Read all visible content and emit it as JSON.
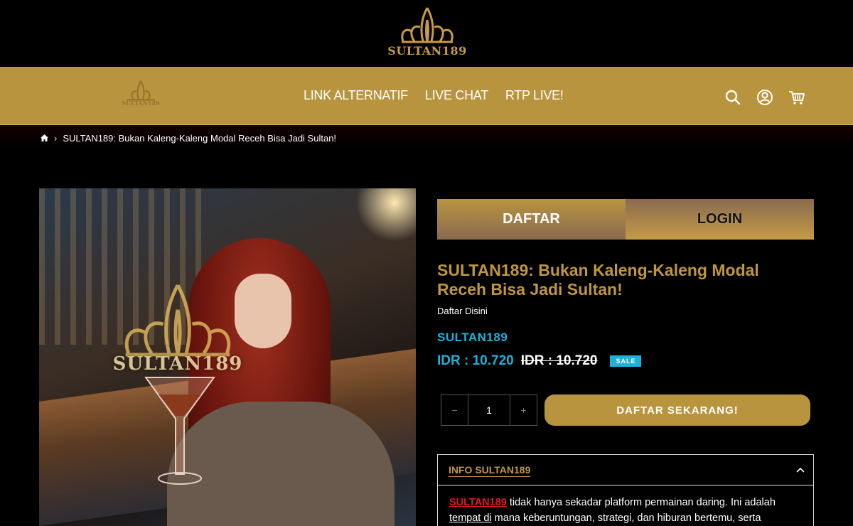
{
  "header": {
    "logo_text": "SULTAN189",
    "nav_logo_text": "SULTAN189",
    "nav_links": [
      "LINK ALTERNATIF",
      "LIVE CHAT",
      "RTP LIVE!"
    ],
    "icons": [
      "search-icon",
      "account-icon",
      "cart-icon"
    ]
  },
  "breadcrumb": {
    "home_icon": "home-icon",
    "separator": "›",
    "current": "SULTAN189: Bukan Kaleng-Kaleng Modal Receh Bisa Jadi Sultan!"
  },
  "product": {
    "image_watermark": "SULTAN189",
    "tabs": {
      "daftar": "DAFTAR",
      "login": "LOGIN"
    },
    "title": "SULTAN189: Bukan Kaleng-Kaleng Modal Receh Bisa Jadi Sultan!",
    "subtitle": "Daftar Disini",
    "vendor": "SULTAN189",
    "price": "IDR : 10.720",
    "compare_price": "IDR : 10.720",
    "sale_badge": "SALE",
    "quantity": {
      "minus": "−",
      "value": "1",
      "plus": "+"
    },
    "cta": "DAFTAR SEKARANG!"
  },
  "info": {
    "title": "INFO SULTAN189",
    "body_brand": "SULTAN189",
    "body_line1": " tidak hanya sekadar platform permainan daring. Ini adalah",
    "body_line2_ul": "tempat di",
    "body_line2": " mana keberuntungan, strategi, dan hiburan bertemu, serta"
  },
  "colors": {
    "gold": "#b8943f",
    "title_gold": "#c0963f",
    "cyan": "#1fb2d8",
    "brand_red": "#e0181f"
  }
}
